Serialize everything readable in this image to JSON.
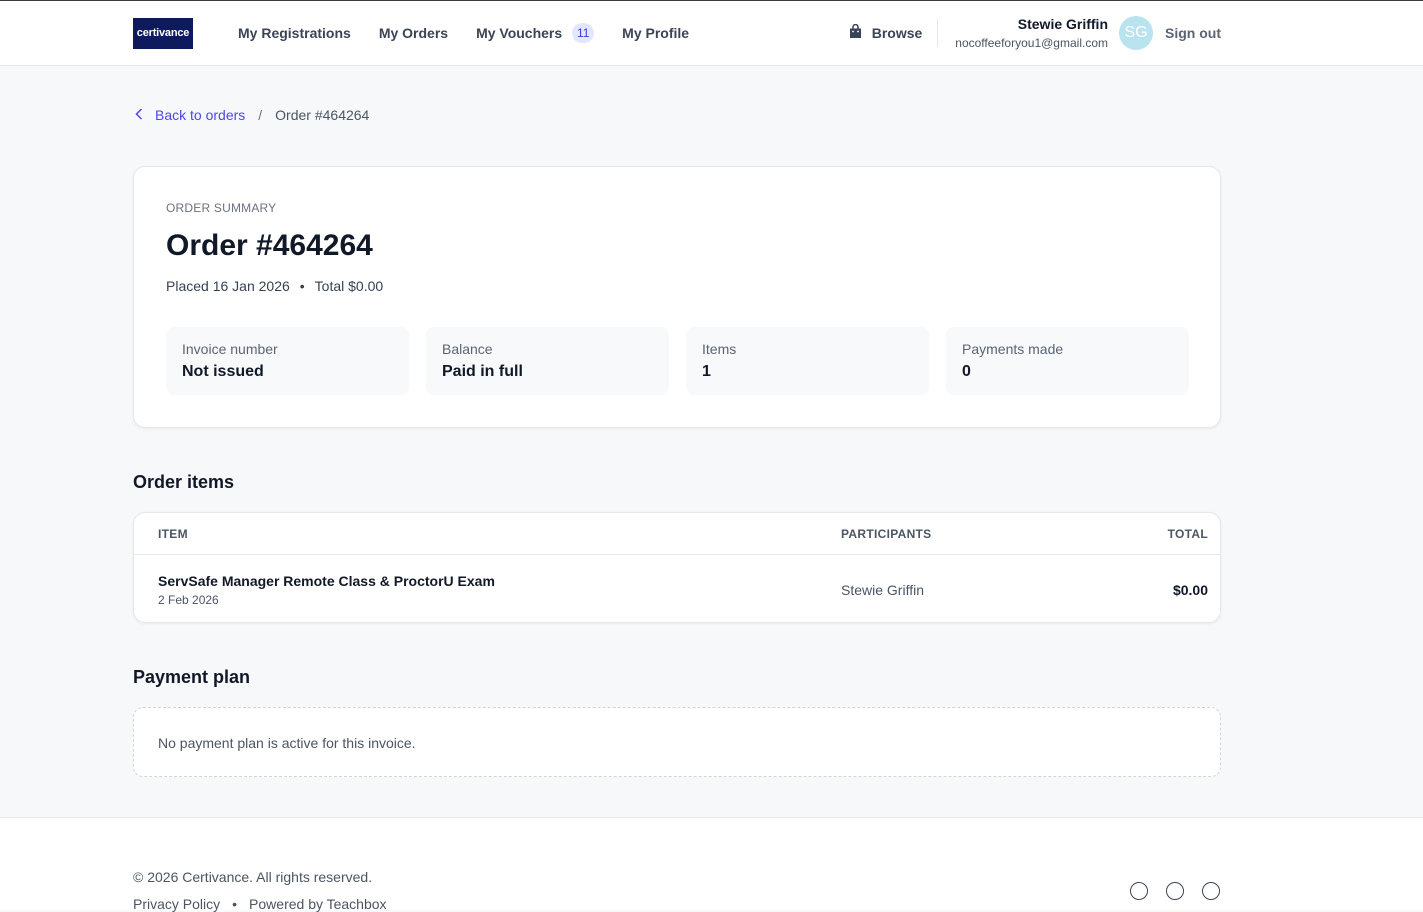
{
  "header": {
    "logo_text": "certivance",
    "nav": [
      {
        "label": "My Registrations"
      },
      {
        "label": "My Orders"
      },
      {
        "label": "My Vouchers",
        "badge": "11"
      },
      {
        "label": "My Profile"
      }
    ],
    "browse_label": "Browse",
    "user_name": "Stewie Griffin",
    "user_email": "nocoffeeforyou1@gmail.com",
    "avatar_initials": "SG",
    "signout_label": "Sign out"
  },
  "breadcrumb": {
    "back_label": "Back to orders",
    "separator": "/",
    "current": "Order #464264"
  },
  "summary": {
    "eyebrow": "ORDER SUMMARY",
    "title": "Order #464264",
    "placed": "Placed 16 Jan 2026",
    "dot": "•",
    "total": "Total $0.00",
    "stats": [
      {
        "label": "Invoice number",
        "value": "Not issued"
      },
      {
        "label": "Balance",
        "value": "Paid in full"
      },
      {
        "label": "Items",
        "value": "1"
      },
      {
        "label": "Payments made",
        "value": "0"
      }
    ]
  },
  "order_items": {
    "title": "Order items",
    "columns": {
      "item": "ITEM",
      "participants": "PARTICIPANTS",
      "total": "TOTAL"
    },
    "rows": [
      {
        "name": "ServSafe Manager Remote Class & ProctorU Exam",
        "date": "2 Feb 2026",
        "participant": "Stewie Griffin",
        "total": "$0.00"
      }
    ]
  },
  "payment_plan": {
    "title": "Payment plan",
    "message": "No payment plan is active for this invoice."
  },
  "footer": {
    "copyright": "© 2026 Certivance. All rights reserved.",
    "privacy": "Privacy Policy",
    "dot": "•",
    "powered": "Powered by Teachbox"
  },
  "colors": {
    "accent": "#4f46e5",
    "logo_bg": "#0d1a5e",
    "avatar_bg": "#b9e3ef"
  }
}
